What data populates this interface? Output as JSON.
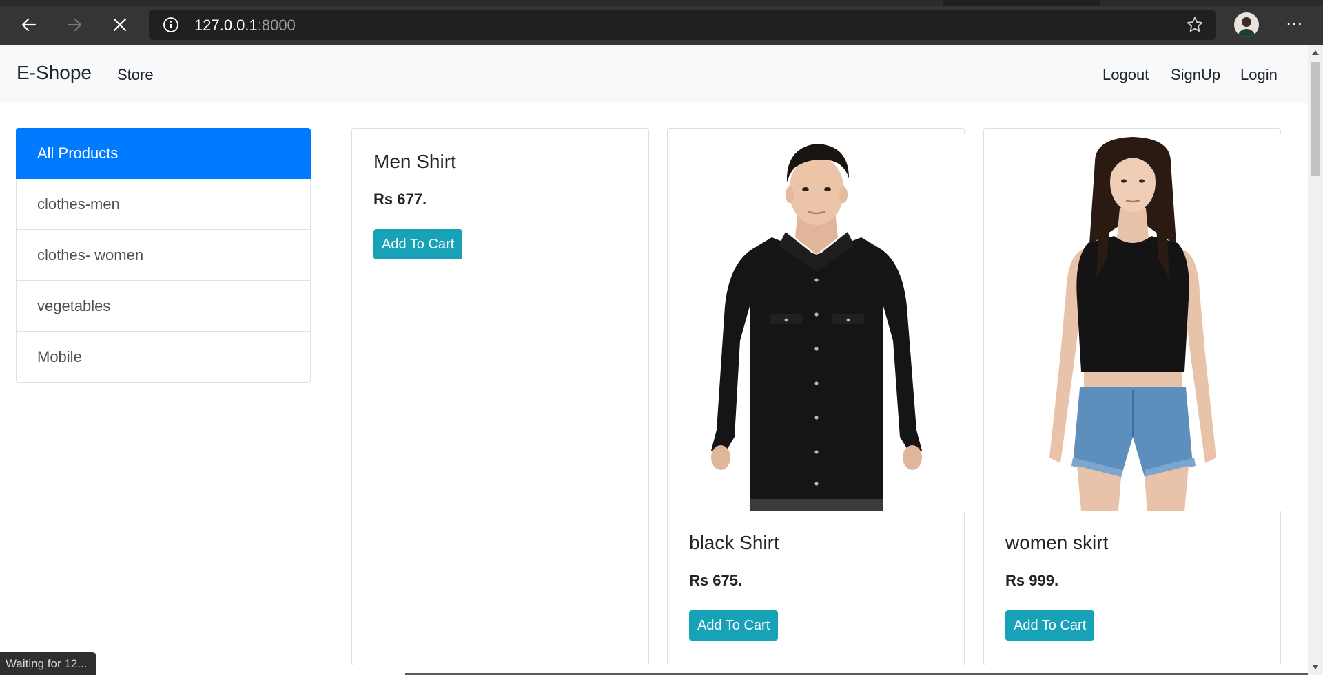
{
  "browser": {
    "url_host": "127.0.0.1",
    "url_port": ":8000",
    "status_text": "Waiting for 12..."
  },
  "navbar": {
    "brand": "E-Shope",
    "store": "Store",
    "logout": "Logout",
    "signup": "SignUp",
    "login": "Login"
  },
  "sidebar": {
    "items": [
      {
        "label": "All Products"
      },
      {
        "label": "clothes-men"
      },
      {
        "label": "clothes- women"
      },
      {
        "label": "vegetables"
      },
      {
        "label": "Mobile"
      }
    ]
  },
  "products": [
    {
      "name": "Men Shirt",
      "price": "Rs 677.",
      "button": "Add To Cart"
    },
    {
      "name": "black Shirt",
      "price": "Rs 675.",
      "button": "Add To Cart"
    },
    {
      "name": "women skirt",
      "price": "Rs 999.",
      "button": "Add To Cart"
    }
  ],
  "colors": {
    "active": "#007bff",
    "cart_button": "#17a2b8",
    "navbar_bg": "#f8f9fa"
  }
}
